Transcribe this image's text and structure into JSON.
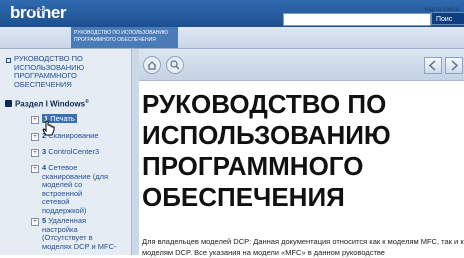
{
  "header": {
    "logo": "brother",
    "search_button": "Поис"
  },
  "nav": {
    "back_label": "Назад",
    "breadcrumb": "РУКОВОДСТВО ПО ИСПОЛЬЗОВАНИЮ ПРОГРАММНОГО ОБЕСПЕЧЕНИЯ",
    "sitemap_label": "Карта сайта"
  },
  "sidebar": {
    "top_link": "РУКОВОДСТВО ПО ИСПОЛЬЗОВАНИЮ ПРОГРАММНОГО ОБЕСПЕЧЕНИЯ",
    "section_title": "Раздел I Windows",
    "section_sup": "®",
    "items": [
      {
        "num": "1",
        "label": "Печать"
      },
      {
        "num": "2",
        "label": "Сканирование"
      },
      {
        "num": "3",
        "label": "ControlCenter3"
      },
      {
        "num": "4",
        "label": "Сетевое сканирование (для моделей со встроенной сетевой поддержкой)"
      },
      {
        "num": "5",
        "label": "Удаленная настройка (Отсутствует в моделях DCP и MFC-"
      }
    ]
  },
  "main": {
    "title": "РУКОВОДСТВО ПО ИСПОЛЬЗОВАНИЮ ПРОГРАММНОГО ОБЕСПЕЧЕНИЯ",
    "paragraph": "Для владельцев моделей DCP: Данная документация относится как к моделям MFC, так и к моделям DCP. Все указания на модели «MFC» в данном руководстве"
  },
  "colors": {
    "brand_blue": "#1d4f8f",
    "link_blue": "#1f4f94",
    "sidebar_bg": "#e6ecf4"
  },
  "icons": [
    "search-icon",
    "home-icon",
    "pointer-cursor-icon",
    "arrow-left-icon",
    "arrow-right-icon",
    "plus-expand-icon"
  ]
}
